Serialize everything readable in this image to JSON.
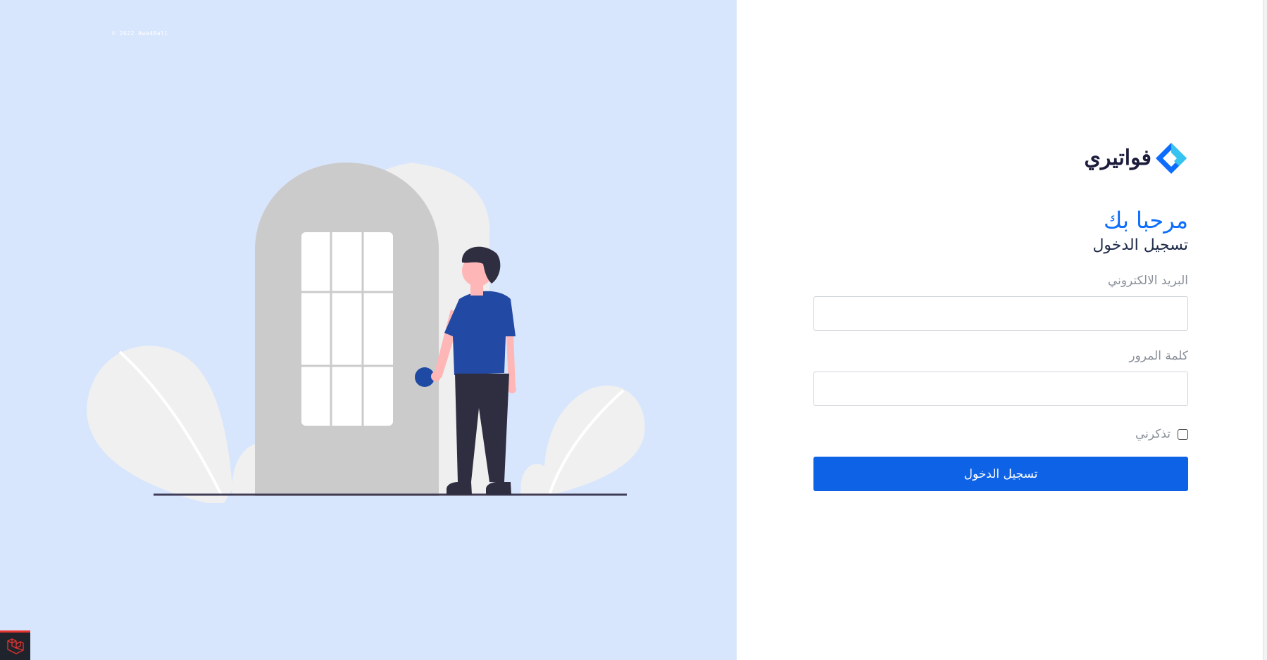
{
  "left_panel": {
    "copyright": "© 2022 Awa4Ball"
  },
  "brand": {
    "name": "فواتيري",
    "logo_icon": "diamond-logo-icon",
    "colors": {
      "logo_dark": "#0d6efd",
      "logo_light": "#36c3f0"
    }
  },
  "login": {
    "welcome": "مرحبا بك",
    "subtitle": "تسجيل الدخول",
    "email_label": "البريد الالكتروني",
    "email_value": "",
    "password_label": "كلمة المرور",
    "password_value": "",
    "remember_label": "تذكرني",
    "remember_checked": false,
    "submit_label": "تسجيل الدخول"
  },
  "colors": {
    "accent": "#0e62e6",
    "left_bg": "#d8e6fd",
    "title": "#0d6efd"
  }
}
